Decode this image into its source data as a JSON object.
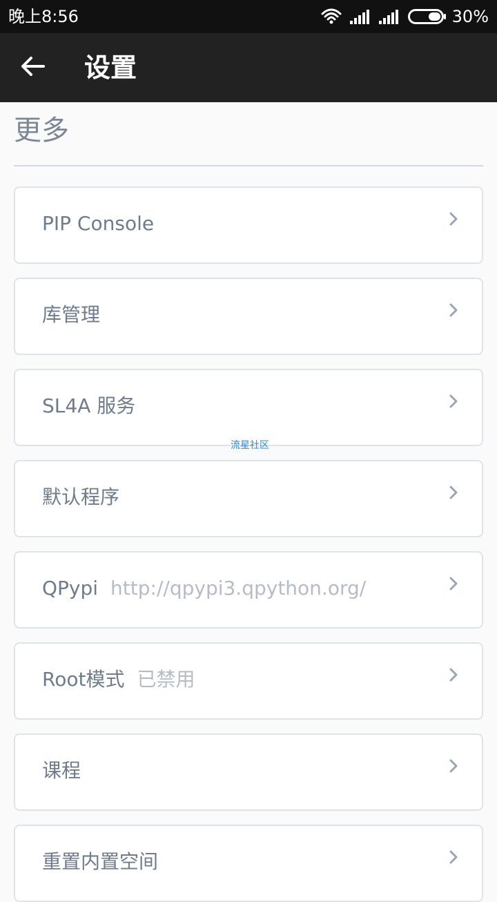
{
  "status_bar": {
    "time": "晚上8:56",
    "battery": "30%"
  },
  "app_bar": {
    "title": "设置"
  },
  "section": {
    "title": "更多"
  },
  "items": [
    {
      "label": "PIP Console",
      "value": ""
    },
    {
      "label": "库管理",
      "value": ""
    },
    {
      "label": "SL4A 服务",
      "value": ""
    },
    {
      "label": "默认程序",
      "value": ""
    },
    {
      "label": "QPypi",
      "value": "http://qpypi3.qpython.org/"
    },
    {
      "label": "Root模式",
      "value": "已禁用"
    },
    {
      "label": "课程",
      "value": ""
    },
    {
      "label": "重置内置空间",
      "value": ""
    }
  ],
  "watermark": "流星社区"
}
